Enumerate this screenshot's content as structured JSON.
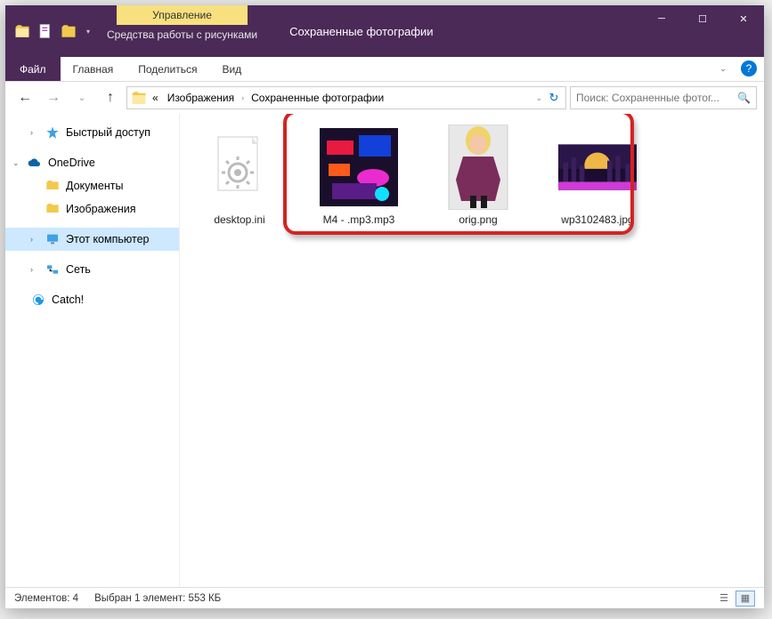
{
  "titlebar": {
    "context_group": "Управление",
    "context_label": "Средства работы с рисунками",
    "title": "Сохраненные фотографии"
  },
  "ribbon": {
    "file": "Файл",
    "tabs": [
      "Главная",
      "Поделиться",
      "Вид"
    ]
  },
  "address": {
    "crumbs": [
      "«",
      "Изображения",
      "Сохраненные фотографии"
    ],
    "search_placeholder": "Поиск: Сохраненные фотог..."
  },
  "sidebar": {
    "quick": "Быстрый доступ",
    "onedrive": "OneDrive",
    "onedrive_children": [
      "Документы",
      "Изображения"
    ],
    "thispc": "Этот компьютер",
    "network": "Сеть",
    "catch": "Catch!"
  },
  "files": [
    {
      "name": "desktop.ini"
    },
    {
      "name": "M4 -  .mp3.mp3"
    },
    {
      "name": "orig.png"
    },
    {
      "name": "wp3102483.jpg"
    }
  ],
  "status": {
    "count": "Элементов: 4",
    "selection": "Выбран 1 элемент: 553 КБ"
  }
}
